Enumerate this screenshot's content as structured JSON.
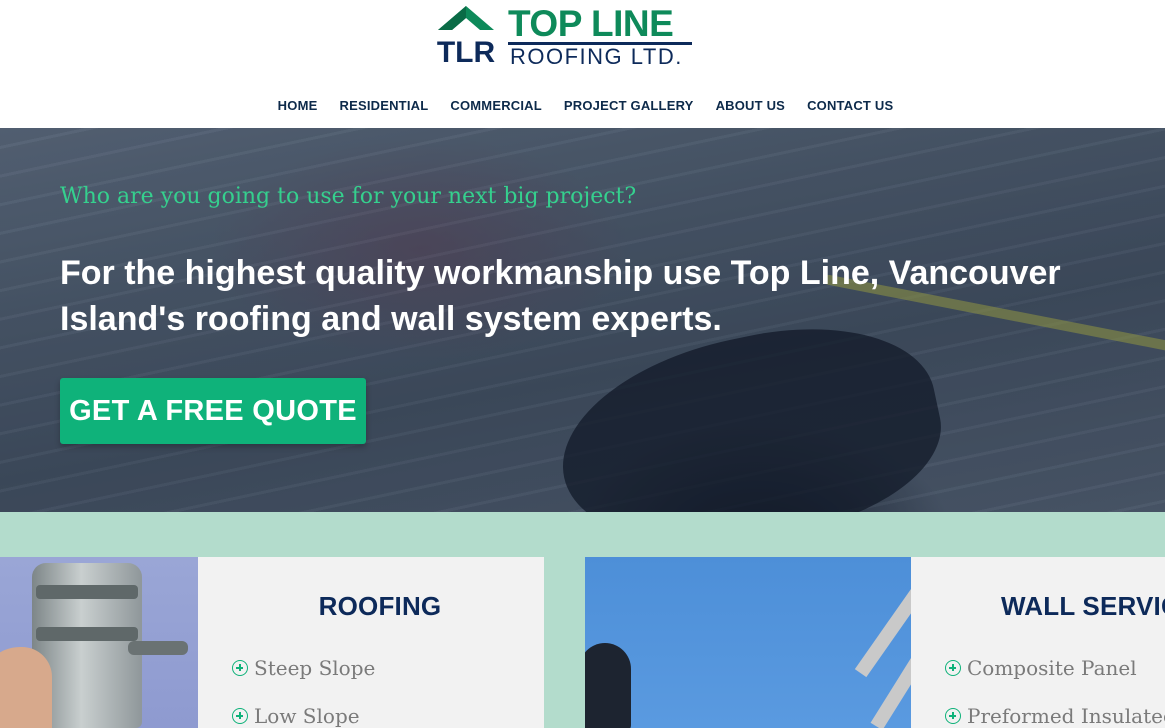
{
  "brand": {
    "name_line1": "TOP LINE",
    "name_line2": "ROOFING LTD.",
    "mark_letters": "TLR",
    "colors": {
      "green": "#0e8a5a",
      "navy": "#0d2a5a"
    }
  },
  "nav": {
    "items": [
      {
        "label": "HOME"
      },
      {
        "label": "RESIDENTIAL"
      },
      {
        "label": "COMMERCIAL"
      },
      {
        "label": "PROJECT GALLERY"
      },
      {
        "label": "ABOUT US"
      },
      {
        "label": "CONTACT US"
      }
    ]
  },
  "hero": {
    "kicker": "Who are you going to use for your next big project?",
    "headline": "For the highest quality workmanship use Top Line, Vancouver Island's roofing and wall system experts.",
    "cta_label": "GET A FREE QUOTE",
    "accent_color": "#0fb27a"
  },
  "services": [
    {
      "title": "ROOFING",
      "items": [
        "Steep Slope",
        "Low Slope"
      ]
    },
    {
      "title": "WALL SERVICES",
      "items": [
        "Composite Panel",
        "Preformed Insulated Panel"
      ]
    }
  ]
}
